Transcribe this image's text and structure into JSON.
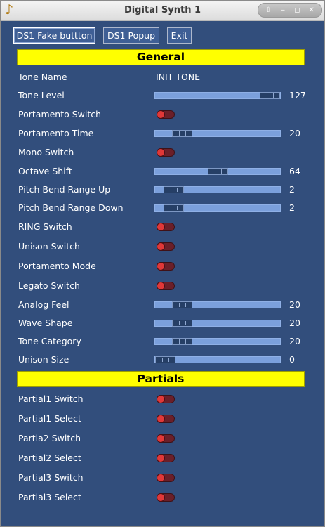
{
  "window": {
    "title": "Digital Synth 1",
    "app_icon": "♪",
    "controls": {
      "up": "⇧",
      "minimize": "‒",
      "maximize": "◻",
      "close": "✕"
    }
  },
  "toolbar": {
    "fake_button_label": "DS1 Fake buttton",
    "popup_label": "DS1 Popup",
    "exit_label": "Exit"
  },
  "general": {
    "header": "General",
    "rows": [
      {
        "label": "Tone Name",
        "type": "text",
        "value": "INIT TONE"
      },
      {
        "label": "Tone Level",
        "type": "slider",
        "value": "127",
        "fraction": 1.0
      },
      {
        "label": "Portamento Switch",
        "type": "toggle",
        "on": false
      },
      {
        "label": "Portamento Time",
        "type": "slider",
        "value": "20",
        "fraction": 0.16
      },
      {
        "label": "Mono Switch",
        "type": "toggle",
        "on": false
      },
      {
        "label": "Octave Shift",
        "type": "slider",
        "value": "64",
        "fraction": 0.5
      },
      {
        "label": "Pitch Bend Range Up",
        "type": "slider",
        "value": "2",
        "fraction": 0.08
      },
      {
        "label": "Pitch Bend Range Down",
        "type": "slider",
        "value": "2",
        "fraction": 0.08
      },
      {
        "label": "RING Switch",
        "type": "toggle",
        "on": false
      },
      {
        "label": "Unison Switch",
        "type": "toggle",
        "on": false
      },
      {
        "label": "Portamento Mode",
        "type": "toggle",
        "on": false
      },
      {
        "label": "Legato Switch",
        "type": "toggle",
        "on": false
      },
      {
        "label": "Analog Feel",
        "type": "slider",
        "value": "20",
        "fraction": 0.16
      },
      {
        "label": "Wave Shape",
        "type": "slider",
        "value": "20",
        "fraction": 0.16
      },
      {
        "label": "Tone Category",
        "type": "slider",
        "value": "20",
        "fraction": 0.16
      },
      {
        "label": "Unison Size",
        "type": "slider",
        "value": "0",
        "fraction": 0.0
      }
    ]
  },
  "partials": {
    "header": "Partials",
    "rows": [
      {
        "label": "Partial1 Switch",
        "type": "toggle",
        "on": false
      },
      {
        "label": "Partial1 Select",
        "type": "toggle",
        "on": false
      },
      {
        "label": "Partia2 Switch",
        "type": "toggle",
        "on": false
      },
      {
        "label": "Partial2 Select",
        "type": "toggle",
        "on": false
      },
      {
        "label": "Partial3 Switch",
        "type": "toggle",
        "on": false
      },
      {
        "label": "Partial3 Select",
        "type": "toggle",
        "on": false
      }
    ]
  },
  "colors": {
    "background": "#324e7c",
    "section_header": "#ffff00",
    "slider_track": "#7ba0dc",
    "slider_thumb": "#263f66",
    "toggle_off_knob": "#e03838"
  }
}
